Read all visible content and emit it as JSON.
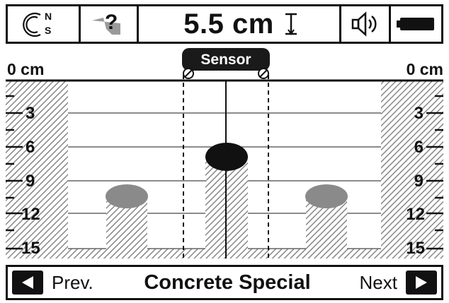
{
  "status_bar": {
    "compass_glyph": "C",
    "compass_north": "N",
    "compass_south": "S",
    "help_label": "?",
    "depth_reading": "5.5 cm",
    "speaker_icon": "speaker-icon",
    "battery_icon": "battery-icon"
  },
  "sensor_label": "Sensor",
  "depth_scale": {
    "top_left": "0 cm",
    "top_right": "0 cm",
    "ticks": [
      "3",
      "6",
      "9",
      "12",
      "15"
    ]
  },
  "targets": [
    {
      "name": "left-object",
      "depth_cm": 11,
      "color": "#8a8a8a"
    },
    {
      "name": "center-object",
      "depth_cm": 5.5,
      "color": "#111111"
    },
    {
      "name": "right-object",
      "depth_cm": 11,
      "color": "#8a8a8a"
    }
  ],
  "nav": {
    "prev_label": "Prev.",
    "mode_title": "Concrete Special",
    "next_label": "Next"
  }
}
